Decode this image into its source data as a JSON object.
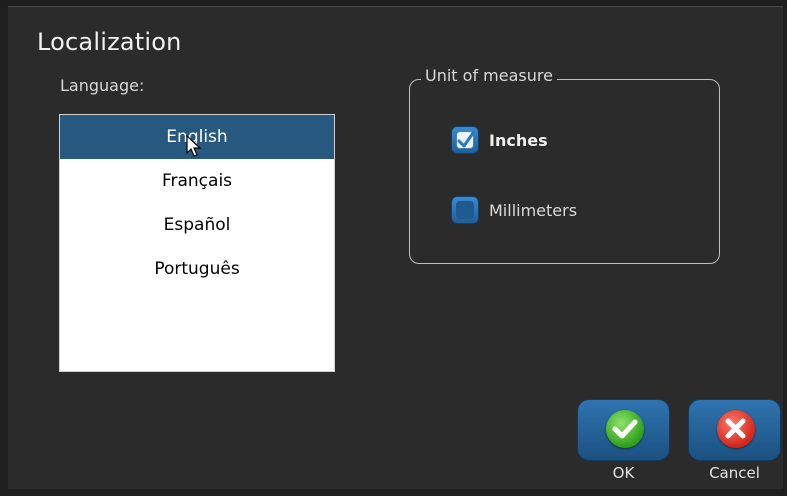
{
  "dialog": {
    "title": "Localization",
    "language_label": "Language:",
    "languages": [
      "English",
      "Français",
      "Español",
      "Português"
    ],
    "selected_language": "English"
  },
  "unit_of_measure": {
    "legend": "Unit of measure",
    "options": [
      {
        "label": "Inches",
        "checked": true
      },
      {
        "label": "Millimeters",
        "checked": false
      }
    ]
  },
  "buttons": {
    "ok_label": "OK",
    "cancel_label": "Cancel",
    "ok_icon": "check-icon",
    "cancel_icon": "x-icon"
  },
  "colors": {
    "background": "#2b2b2b",
    "selection": "#27587f",
    "button": "#2f74b0",
    "ok": "#2ea01b",
    "cancel": "#d4251a"
  }
}
